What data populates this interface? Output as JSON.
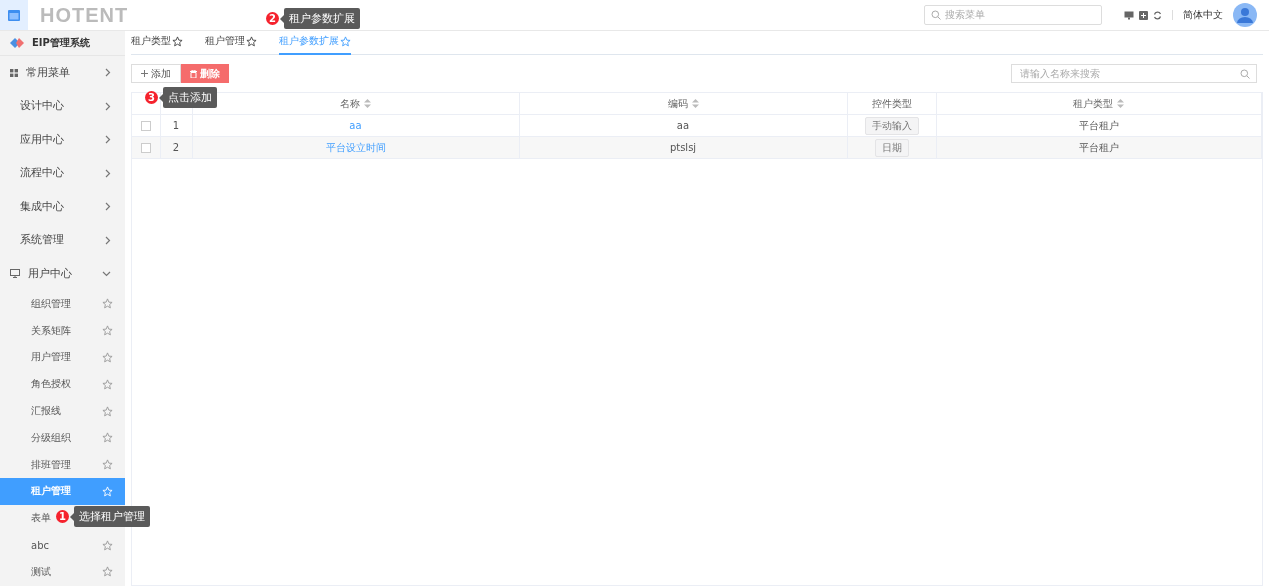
{
  "header": {
    "logo": "HOTENT",
    "search": {
      "placeholder": "搜索菜单"
    },
    "language": "简体中文"
  },
  "sidebar": {
    "title": "EIP管理系统",
    "groups": [
      {
        "label": "常用菜单",
        "kind": "favorites",
        "expanded": false
      },
      {
        "label": "设计中心",
        "kind": "plain",
        "expanded": false
      },
      {
        "label": "应用中心",
        "kind": "plain",
        "expanded": false
      },
      {
        "label": "流程中心",
        "kind": "plain",
        "expanded": false
      },
      {
        "label": "集成中心",
        "kind": "plain",
        "expanded": false
      },
      {
        "label": "系统管理",
        "kind": "plain",
        "expanded": false
      },
      {
        "label": "用户中心",
        "kind": "users",
        "expanded": true,
        "children": [
          {
            "label": "组织管理",
            "selected": false,
            "star": true
          },
          {
            "label": "关系矩阵",
            "selected": false,
            "star": true
          },
          {
            "label": "用户管理",
            "selected": false,
            "star": true
          },
          {
            "label": "角色授权",
            "selected": false,
            "star": true
          },
          {
            "label": "汇报线",
            "selected": false,
            "star": true
          },
          {
            "label": "分级组织",
            "selected": false,
            "star": true
          },
          {
            "label": "排班管理",
            "selected": false,
            "star": true
          },
          {
            "label": "租户管理",
            "selected": true,
            "star": true
          },
          {
            "label": "表单",
            "selected": false,
            "star": false
          },
          {
            "label": "abc",
            "selected": false,
            "star": true
          },
          {
            "label": "测试",
            "selected": false,
            "star": true
          }
        ]
      }
    ]
  },
  "tabs": [
    {
      "label": "租户类型",
      "selected": false
    },
    {
      "label": "租户管理",
      "selected": false
    },
    {
      "label": "租户参数扩展",
      "selected": true
    }
  ],
  "toolbar": {
    "add": "添加",
    "delete": "删除",
    "search": {
      "placeholder": "请输入名称来搜索"
    }
  },
  "table": {
    "columns": [
      {
        "label": "名称",
        "sortable": true
      },
      {
        "label": "编码",
        "sortable": true
      },
      {
        "label": "控件类型",
        "sortable": false
      },
      {
        "label": "租户类型",
        "sortable": true
      }
    ],
    "rows": [
      {
        "checked": false,
        "index": "1",
        "name": "aa",
        "code": "aa",
        "control_type": "手动输入",
        "tenant_type": "平台租户"
      },
      {
        "checked": false,
        "index": "2",
        "name": "平台设立时间",
        "code": "ptslsj",
        "control_type": "日期",
        "tenant_type": "平台租户"
      }
    ]
  },
  "annotations": [
    {
      "number": "2",
      "text": "租户参数扩展"
    },
    {
      "number": "3",
      "text": "点击添加"
    },
    {
      "number": "1",
      "text": "选择租户管理"
    }
  ]
}
